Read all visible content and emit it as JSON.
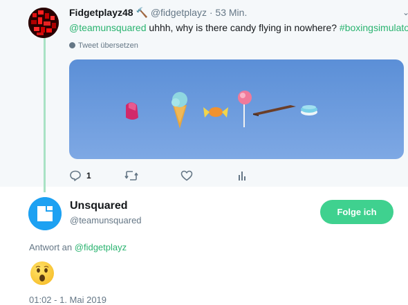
{
  "parent_tweet": {
    "display_name": "Fidgetplayz48",
    "name_emoji": "🔨",
    "handle": "@fidgetplayz",
    "separator": "·",
    "time": "53 Min.",
    "caret": "⌄",
    "text_mention": "@teamunsquared",
    "text_body": " uhhh, why is there candy flying in nowhere? ",
    "text_hashtag": "#boxingsimulator",
    "translate_label": "Tweet übersetzen",
    "reply_count": "1",
    "icons": [
      "reply-icon",
      "retweet-icon",
      "like-icon",
      "analytics-icon"
    ]
  },
  "main_tweet": {
    "display_name": "Unsquared",
    "handle": "@teamunsquared",
    "follow_label": "Folge ich",
    "reply_prefix": "Antwort an ",
    "reply_handle": "@fidgetplayz",
    "emoji": "😯",
    "timestamp": "01:02 - 1. Mai 2019"
  },
  "colors": {
    "accent": "#29b36f",
    "follow_button": "#3fd18f",
    "thread_line": "#a8e2c4",
    "secondary_text": "#657786",
    "avatar_blue": "#1da1f2"
  }
}
